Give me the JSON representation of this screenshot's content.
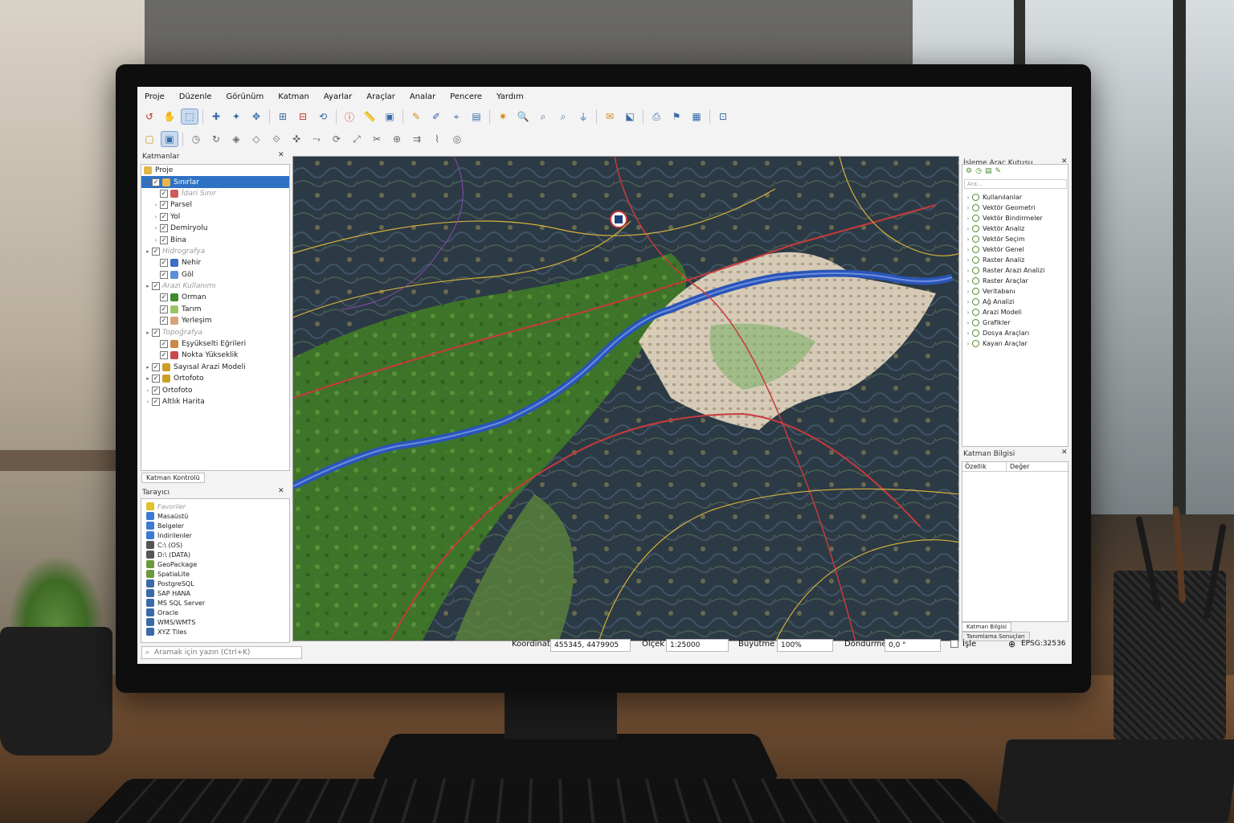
{
  "menubar": {
    "items": [
      "Proje",
      "Düzenle",
      "Görünüm",
      "Katman",
      "Ayarlar",
      "Araçlar",
      "Analar",
      "Pencere",
      "Yardım"
    ]
  },
  "layers_panel": {
    "title": "Katmanlar",
    "close": "✕",
    "project_label": "Proje",
    "items": [
      {
        "label": "Sınırlar",
        "selected": true,
        "dim": false,
        "indent": 0,
        "arrow": "▸",
        "icon": "polygon-layer-icon",
        "color": "#e8b84a"
      },
      {
        "label": "İdari Sınır",
        "selected": false,
        "dim": true,
        "indent": 1,
        "arrow": "",
        "icon": "polygon-layer-icon",
        "color": "#d05a5a"
      },
      {
        "label": "Parsel",
        "selected": false,
        "dim": false,
        "indent": 1,
        "arrow": "›",
        "icon": "checkbox-icon",
        "color": ""
      },
      {
        "label": "Yol",
        "selected": false,
        "dim": false,
        "indent": 1,
        "arrow": "›",
        "icon": "checkbox-icon",
        "color": ""
      },
      {
        "label": "Demiryolu",
        "selected": false,
        "dim": false,
        "indent": 1,
        "arrow": "›",
        "icon": "checkbox-icon",
        "color": ""
      },
      {
        "label": "Bina",
        "selected": false,
        "dim": false,
        "indent": 1,
        "arrow": "›",
        "icon": "checkbox-icon",
        "color": ""
      },
      {
        "label": "Hidrografya",
        "selected": false,
        "dim": true,
        "indent": 0,
        "arrow": "▸",
        "icon": "checkbox-icon",
        "color": ""
      },
      {
        "label": "Nehir",
        "selected": false,
        "dim": false,
        "indent": 1,
        "arrow": "",
        "icon": "line-layer-icon",
        "color": "#3d6fc4"
      },
      {
        "label": "Göl",
        "selected": false,
        "dim": false,
        "indent": 1,
        "arrow": "",
        "icon": "polygon-layer-icon",
        "color": "#5b8fd8"
      },
      {
        "label": "Arazi Kullanımı",
        "selected": false,
        "dim": true,
        "indent": 0,
        "arrow": "▸",
        "icon": "checkbox-icon",
        "color": ""
      },
      {
        "label": "Orman",
        "selected": false,
        "dim": false,
        "indent": 1,
        "arrow": "",
        "icon": "polygon-layer-icon",
        "color": "#3f8a2e"
      },
      {
        "label": "Tarım",
        "selected": false,
        "dim": false,
        "indent": 1,
        "arrow": "",
        "icon": "polygon-layer-icon",
        "color": "#9ac468"
      },
      {
        "label": "Yerleşim",
        "selected": false,
        "dim": false,
        "indent": 1,
        "arrow": "",
        "icon": "polygon-layer-icon",
        "color": "#d7a37a"
      },
      {
        "label": "Topoğrafya",
        "selected": false,
        "dim": true,
        "indent": 0,
        "arrow": "▸",
        "icon": "checkbox-icon",
        "color": ""
      },
      {
        "label": "Eşyükselti Eğrileri",
        "selected": false,
        "dim": false,
        "indent": 1,
        "arrow": "",
        "icon": "line-layer-icon",
        "color": "#c98a4a"
      },
      {
        "label": "Nokta Yükseklik",
        "selected": false,
        "dim": false,
        "indent": 1,
        "arrow": "",
        "icon": "point-layer-icon",
        "color": "#c94a4a"
      },
      {
        "label": "Sayısal Arazi Modeli",
        "selected": false,
        "dim": false,
        "indent": 0,
        "arrow": "▸",
        "icon": "raster-layer-icon",
        "color": "#c8a028"
      },
      {
        "label": "Ortofoto",
        "selected": false,
        "dim": false,
        "indent": 0,
        "arrow": "▸",
        "icon": "raster-layer-icon",
        "color": "#c8a028"
      },
      {
        "label": "Ortofoto",
        "selected": false,
        "dim": false,
        "indent": 0,
        "arrow": "›",
        "icon": "checkbox-icon",
        "color": ""
      },
      {
        "label": "Altlık Harita",
        "selected": false,
        "dim": false,
        "indent": 0,
        "arrow": "›",
        "icon": "checkbox-icon",
        "color": ""
      }
    ],
    "tab_label": "Katman Kontrolü"
  },
  "browser_panel": {
    "title": "Tarayıcı",
    "close": "✕",
    "items": [
      {
        "label": "Favoriler",
        "icon": "star-icon",
        "dim": true,
        "color": "#e6c02a"
      },
      {
        "label": "Masaüstü",
        "icon": "desktop-icon",
        "dim": false,
        "color": "#3a7bd5"
      },
      {
        "label": "Belgeler",
        "icon": "folder-icon",
        "dim": false,
        "color": "#3a7bd5"
      },
      {
        "label": "İndirilenler",
        "icon": "download-icon",
        "dim": false,
        "color": "#3a7bd5"
      },
      {
        "label": "C:\\ (OS)",
        "icon": "drive-icon",
        "dim": false,
        "color": "#555"
      },
      {
        "label": "D:\\ (DATA)",
        "icon": "drive-icon",
        "dim": false,
        "color": "#555"
      },
      {
        "label": "GeoPackage",
        "icon": "geopackage-icon",
        "dim": false,
        "color": "#6a9a3a"
      },
      {
        "label": "SpatiaLite",
        "icon": "spatialite-icon",
        "dim": false,
        "color": "#6a9a3a"
      },
      {
        "label": "PostgreSQL",
        "icon": "postgresql-icon",
        "dim": false,
        "color": "#3a6aa8"
      },
      {
        "label": "SAP HANA",
        "icon": "database-icon",
        "dim": false,
        "color": "#3a6aa8"
      },
      {
        "label": "MS SQL Server",
        "icon": "database-icon",
        "dim": false,
        "color": "#3a6aa8"
      },
      {
        "label": "Oracle",
        "icon": "database-icon",
        "dim": false,
        "color": "#3a6aa8"
      },
      {
        "label": "WMS/WMTS",
        "icon": "globe-icon",
        "dim": false,
        "color": "#3a6aa8"
      },
      {
        "label": "XYZ Tiles",
        "icon": "tiles-icon",
        "dim": false,
        "color": "#3a6aa8"
      }
    ]
  },
  "search": {
    "placeholder": "Aramak için yazın (Ctrl+K)"
  },
  "toolbox_panel": {
    "title": "İşleme Araç Kutusu",
    "close": "✕",
    "search_placeholder": "Ara...",
    "items": [
      "Kullanılanlar",
      "Vektör Geometri",
      "Vektör Bindirmeler",
      "Vektör Analiz",
      "Vektör Seçim",
      "Vektör Genel",
      "Raster Analiz",
      "Raster Arazi Analizi",
      "Raster Araçlar",
      "Veritabanı",
      "Ağ Analizi",
      "Arazi Modeli",
      "Grafikler",
      "Dosya Araçları",
      "Kayan Araçlar"
    ]
  },
  "layerinfo_panel": {
    "title": "Katman Bilgisi",
    "close": "✕",
    "col_property": "Özellik",
    "col_value": "Değer",
    "tabs": [
      "Katman Bilgisi",
      "Tanımlama Sonuçları"
    ]
  },
  "statusbar": {
    "coord_label": "Koordinat",
    "coord_value": "455345, 4479905",
    "scale_label": "Ölçek",
    "scale_value": "1:25000",
    "zoom_label": "Büyütme",
    "zoom_value": "100%",
    "rotation_label": "Döndürme",
    "rotation_value": "0,0 °",
    "render_label": "İşle",
    "crs_label": "EPSG:32536"
  },
  "colors": {
    "selection": "#2f72c4",
    "river": "#2a55b8",
    "forest": "#3f7a26",
    "urban": "#e6d8c4",
    "roads": "#c83a3a",
    "contours": "#d8b23a"
  }
}
